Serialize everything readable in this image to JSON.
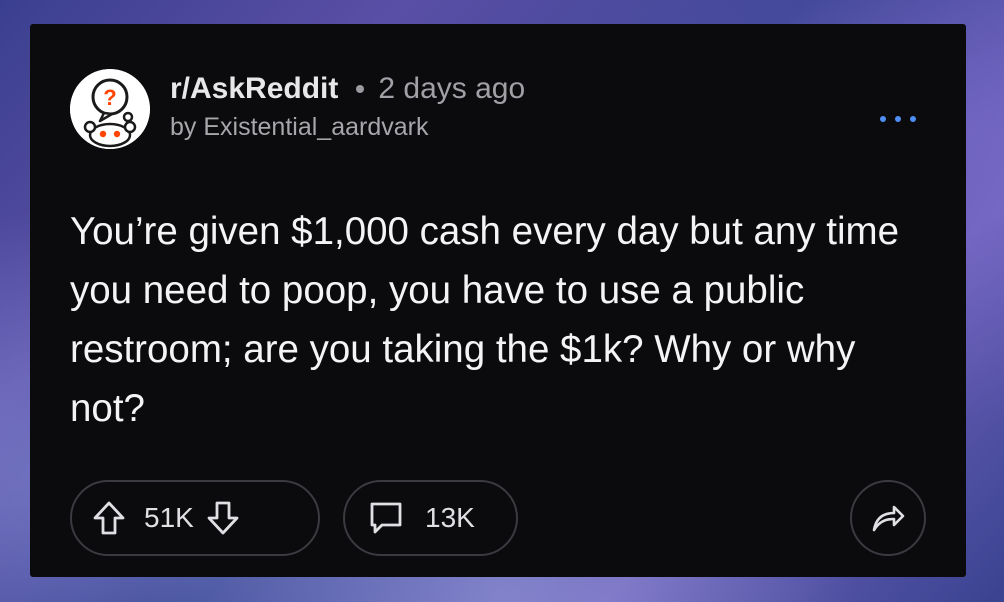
{
  "post": {
    "subreddit": "r/AskReddit",
    "time": "2 days ago",
    "author": "by Existential_aardvark",
    "title": "You’re given $1,000 cash every day but any time you need to poop, you have to use a public restroom; are you taking the $1k? Why or why not?",
    "upvotes": "51K",
    "comments": "13K"
  },
  "colors": {
    "card_bg": "#0b0b0d",
    "accent_blue": "#4f8ff5",
    "text_primary": "#f4f4f6",
    "text_secondary": "#a0a0a6",
    "avatar_orange": "#ff4500"
  },
  "icons": {
    "avatar": "askreddit-snoo-question-icon",
    "more": "ellipsis-icon",
    "upvote": "arrow-up-icon",
    "downvote": "arrow-down-icon",
    "comment": "comment-bubble-icon",
    "share": "share-arrow-icon"
  }
}
